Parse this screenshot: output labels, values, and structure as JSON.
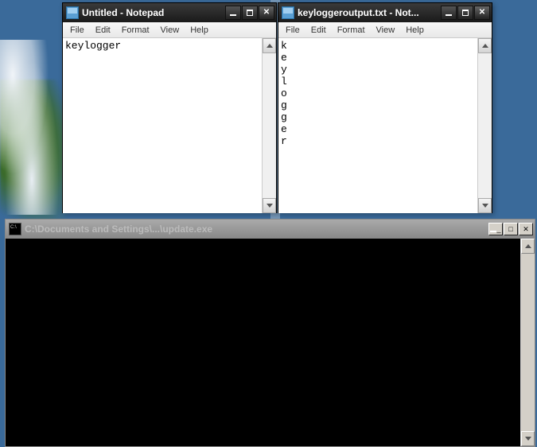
{
  "window1": {
    "title": "Untitled - Notepad",
    "menu": {
      "file": "File",
      "edit": "Edit",
      "format": "Format",
      "view": "View",
      "help": "Help"
    },
    "content": "keylogger"
  },
  "window2": {
    "title": "keyloggeroutput.txt - Not...",
    "menu": {
      "file": "File",
      "edit": "Edit",
      "format": "Format",
      "view": "View",
      "help": "Help"
    },
    "content": "k\ne\ny\nl\no\ng\ng\ne\nr"
  },
  "console": {
    "title": "C:\\Documents and Settings\\...\\update.exe",
    "content": ""
  }
}
